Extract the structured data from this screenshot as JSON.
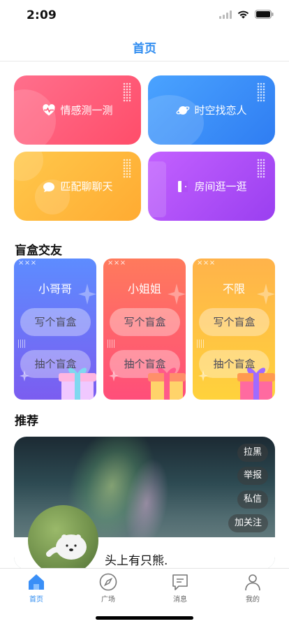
{
  "status_bar": {
    "time": "2:09"
  },
  "nav": {
    "title": "首页"
  },
  "features": [
    {
      "label": "情感测一测",
      "icon": "heart-pulse-icon",
      "color": "#ff5675"
    },
    {
      "label": "时空找恋人",
      "icon": "planet-icon",
      "color": "#3a8ff7"
    },
    {
      "label": "匹配聊聊天",
      "icon": "chat-bubble-icon",
      "color": "#ffb93c"
    },
    {
      "label": "房间逛一逛",
      "icon": "door-icon",
      "color": "#ad4ff6"
    }
  ],
  "blind_box": {
    "section_title": "盲盒交友",
    "cards": [
      {
        "tag": "×××",
        "title": "小哥哥",
        "write_label": "写个盲盒",
        "draw_label": "抽个盲盒"
      },
      {
        "tag": "×××",
        "title": "小姐姐",
        "write_label": "写个盲盒",
        "draw_label": "抽个盲盒"
      },
      {
        "tag": "×××",
        "title": "不限",
        "write_label": "写个盲盒",
        "draw_label": "抽个盲盒"
      }
    ]
  },
  "recommend": {
    "section_title": "推荐",
    "actions": [
      "拉黑",
      "举报",
      "私信",
      "加关注"
    ],
    "user_name": "头上有只熊."
  },
  "tab_bar": {
    "items": [
      {
        "label": "首页",
        "icon": "home-icon",
        "active": true
      },
      {
        "label": "广场",
        "icon": "compass-icon",
        "active": false
      },
      {
        "label": "消息",
        "icon": "message-icon",
        "active": false
      },
      {
        "label": "我的",
        "icon": "person-icon",
        "active": false
      }
    ]
  },
  "colors": {
    "accent": "#2f8cf0"
  }
}
